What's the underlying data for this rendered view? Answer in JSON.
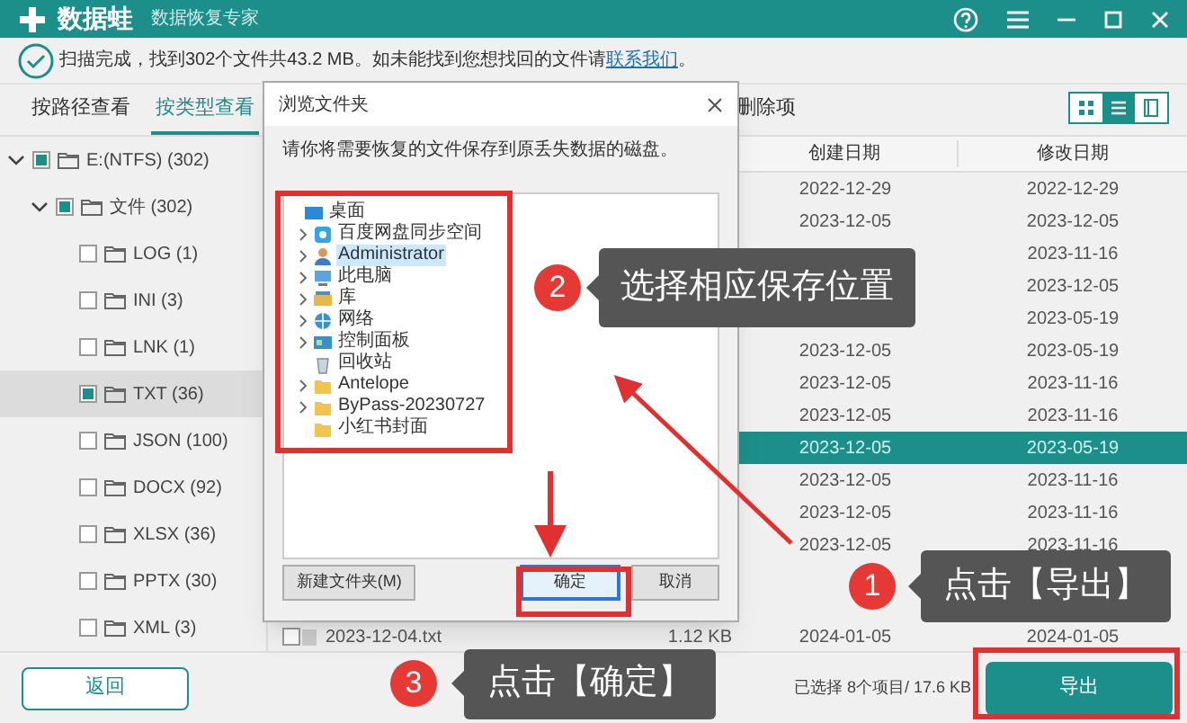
{
  "app": {
    "title": "数据蛙",
    "subtitle": "数据恢复专家"
  },
  "scan_status": {
    "text_before": "扫描完成，找到302个文件共43.2 MB。如未能找到您想找回的文件请",
    "link": "联系我们",
    "text_after": "。"
  },
  "tabs": [
    {
      "label": "按路径查看",
      "selected": false
    },
    {
      "label": "按类型查看",
      "selected": true
    },
    {
      "label": "删除项",
      "selected": false
    }
  ],
  "view_modes": [
    {
      "kind": "grid",
      "selected": false
    },
    {
      "kind": "list",
      "selected": true
    },
    {
      "kind": "detail",
      "selected": false
    }
  ],
  "tree": [
    {
      "label": "E:(NTFS) (302)",
      "checked": true,
      "expanded": true,
      "selected": false,
      "children": [
        {
          "label": "文件 (302)",
          "checked": true,
          "expanded": true,
          "selected": false,
          "children": [
            {
              "label": "LOG (1)",
              "checked": false,
              "selected": false
            },
            {
              "label": "INI (3)",
              "checked": false,
              "selected": false
            },
            {
              "label": "LNK (1)",
              "checked": false,
              "selected": false
            },
            {
              "label": "TXT (36)",
              "checked": true,
              "selected": true
            },
            {
              "label": "JSON (100)",
              "checked": false,
              "selected": false
            },
            {
              "label": "DOCX (92)",
              "checked": false,
              "selected": false
            },
            {
              "label": "XLSX (36)",
              "checked": false,
              "selected": false
            },
            {
              "label": "PPTX (30)",
              "checked": false,
              "selected": false
            },
            {
              "label": "XML (3)",
              "checked": false,
              "selected": false
            }
          ]
        }
      ]
    }
  ],
  "table": {
    "columns": [
      "创建日期",
      "修改日期"
    ],
    "rows": [
      {
        "created": "2022-12-29",
        "modified": "2022-12-29",
        "selected": false
      },
      {
        "created": "2023-12-05",
        "modified": "2023-12-05",
        "selected": false
      },
      {
        "modified": "2023-11-16",
        "selected": false
      },
      {
        "modified": "2023-12-05",
        "selected": false
      },
      {
        "modified": "2023-05-19",
        "selected": false
      },
      {
        "created": "2023-12-05",
        "modified": "2023-05-19",
        "selected": false
      },
      {
        "created": "2023-12-05",
        "modified": "2023-11-16",
        "selected": false
      },
      {
        "created": "2023-12-05",
        "modified": "2023-11-16",
        "selected": false
      },
      {
        "created": "2023-12-05",
        "modified": "2023-05-19",
        "selected": true
      },
      {
        "created": "2023-12-05",
        "modified": "2023-11-16",
        "selected": false
      },
      {
        "created": "2023-12-05",
        "modified": "2023-11-16",
        "selected": false
      },
      {
        "created": "2023-12-05",
        "modified": "2023-11-16",
        "selected": false
      }
    ],
    "last_row": {
      "name": "2023-12-04.txt",
      "size": "1.12 KB",
      "created": "2024-01-05",
      "modified": "2024-01-05",
      "checked": false
    }
  },
  "dialog": {
    "title": "浏览文件夹",
    "instruction": "请你将需要恢复的文件保存到原丢失数据的磁盘。",
    "tree": [
      {
        "label": "桌面",
        "kind": "desktop",
        "expandable": false,
        "selected": false,
        "children": [
          {
            "label": "百度网盘同步空间",
            "kind": "cloud",
            "expandable": true,
            "selected": false
          },
          {
            "label": "Administrator",
            "kind": "user",
            "expandable": true,
            "selected": true
          },
          {
            "label": "此电脑",
            "kind": "computer",
            "expandable": true,
            "selected": false
          },
          {
            "label": "库",
            "kind": "library",
            "expandable": true,
            "selected": false
          },
          {
            "label": "网络",
            "kind": "network",
            "expandable": true,
            "selected": false
          },
          {
            "label": "控制面板",
            "kind": "control",
            "expandable": true,
            "selected": false
          },
          {
            "label": "回收站",
            "kind": "recycle",
            "expandable": false,
            "selected": false
          },
          {
            "label": "Antelope",
            "kind": "folder",
            "expandable": true,
            "selected": false
          },
          {
            "label": "ByPass-20230727",
            "kind": "folder",
            "expandable": true,
            "selected": false
          },
          {
            "label": "小红书封面",
            "kind": "folder",
            "expandable": false,
            "selected": false
          }
        ]
      }
    ],
    "buttons": [
      {
        "label": "新建文件夹(M)",
        "kind": "secondary"
      },
      {
        "label": "确定",
        "kind": "default"
      },
      {
        "label": "取消",
        "kind": "secondary"
      }
    ]
  },
  "footer": {
    "back_button": "返回",
    "selection": "已选择 8个项目/ 17.6 KB",
    "export_button": "导出"
  },
  "annotations": [
    {
      "number": "2",
      "text": "选择相应保存位置"
    },
    {
      "number": "1",
      "text": "点击【导出】"
    },
    {
      "number": "3",
      "text": "点击【确定】"
    }
  ]
}
